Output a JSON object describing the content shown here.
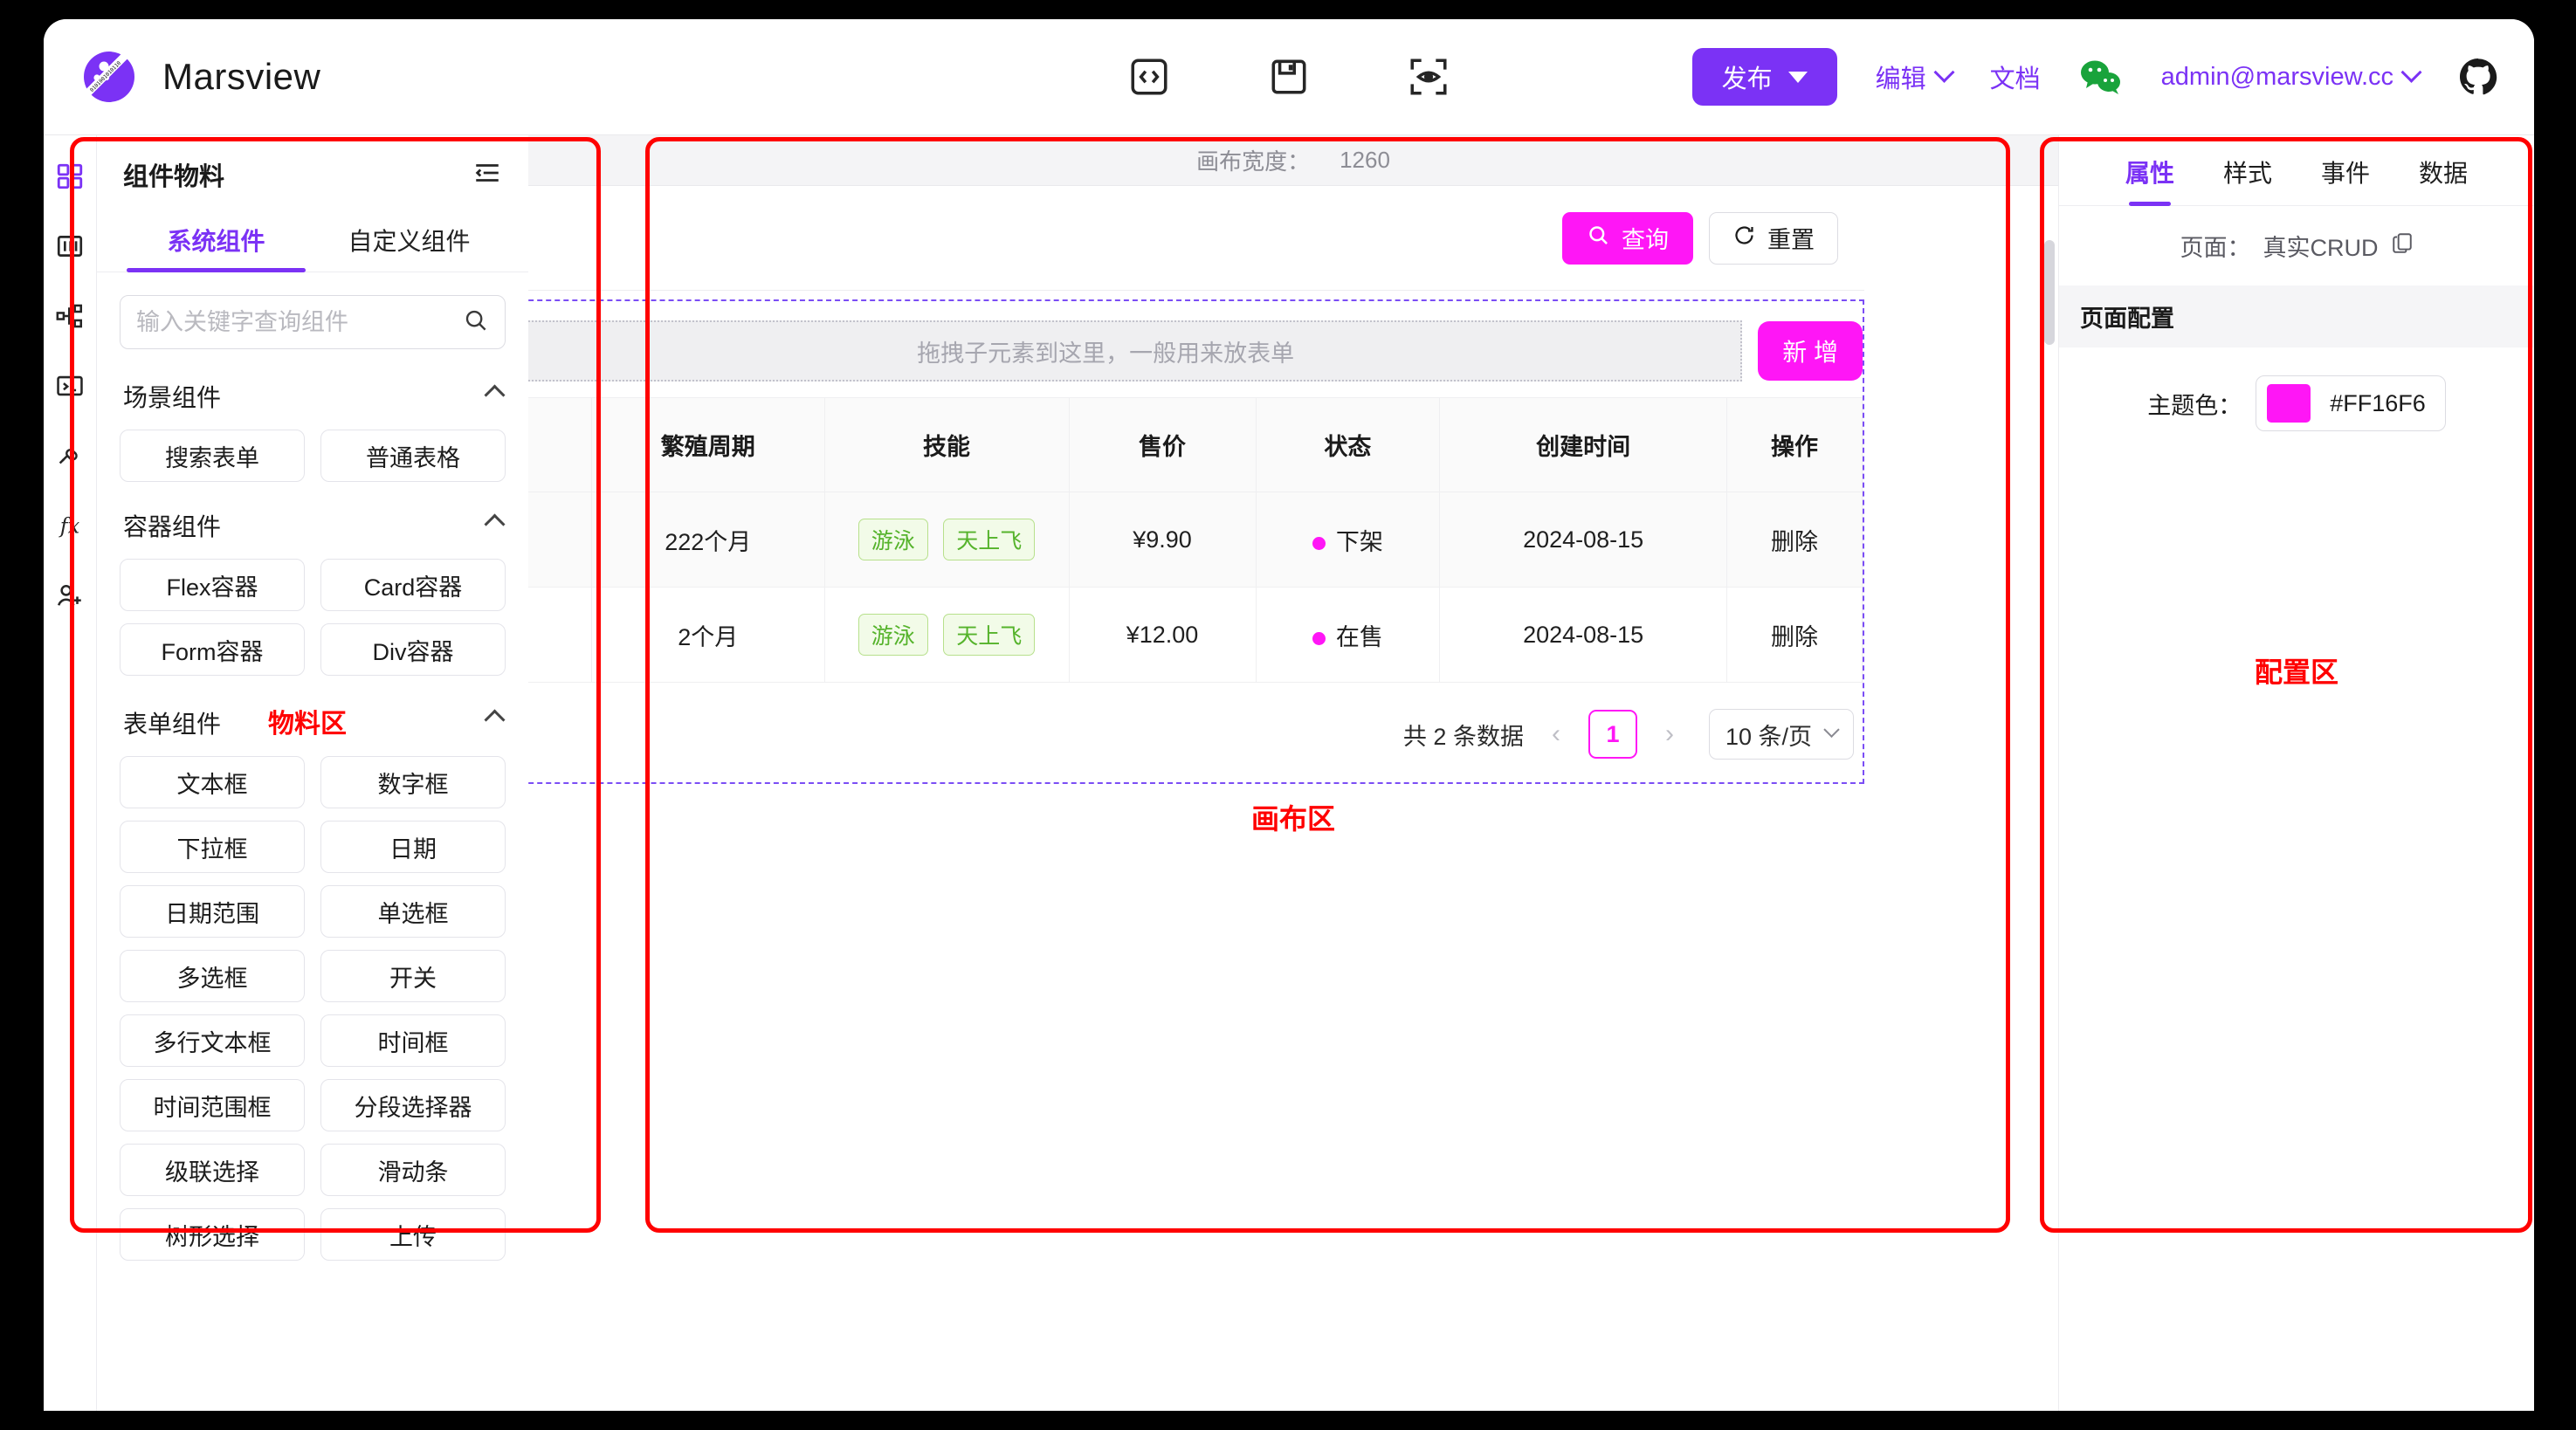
{
  "header": {
    "brand": "Marsview",
    "tools": [
      {
        "name": "code-icon",
        "label": "代码"
      },
      {
        "name": "save-icon",
        "label": "保存"
      },
      {
        "name": "preview-icon",
        "label": "预览"
      }
    ],
    "publish_label": "发布",
    "edit_label": "编辑",
    "docs_label": "文档",
    "wechat_label": "微信",
    "account": "admin@marsview.cc",
    "github_label": "GitHub",
    "brand_color": "#7b32f5"
  },
  "rail": {
    "items": [
      {
        "icon": "grid-icon",
        "label": "组件",
        "active": true
      },
      {
        "icon": "layout-icon",
        "label": "布局",
        "active": false
      },
      {
        "icon": "tree-icon",
        "label": "大纲树",
        "active": false
      },
      {
        "icon": "terminal-icon",
        "label": "代码",
        "active": false
      },
      {
        "icon": "plugin-icon",
        "label": "插件",
        "active": false
      },
      {
        "icon": "function-icon",
        "label": "函数",
        "active": false
      },
      {
        "icon": "user-add-icon",
        "label": "协作",
        "active": false
      }
    ]
  },
  "material": {
    "title": "组件物料",
    "collapse_icon": "collapse-panel-icon",
    "tabs": [
      {
        "label": "系统组件",
        "active": true
      },
      {
        "label": "自定义组件",
        "active": false
      }
    ],
    "search_placeholder": "输入关键字查询组件",
    "search_value": "",
    "annotation": "物料区",
    "groups": [
      {
        "title": "场景组件",
        "collapsed": false,
        "note": "",
        "items": [
          "搜索表单",
          "普通表格"
        ]
      },
      {
        "title": "容器组件",
        "collapsed": false,
        "note": "",
        "items": [
          "Flex容器",
          "Card容器",
          "Form容器",
          "Div容器"
        ]
      },
      {
        "title": "表单组件",
        "collapsed": false,
        "note": "物料区",
        "items": [
          "文本框",
          "数字框",
          "下拉框",
          "日期",
          "日期范围",
          "单选框",
          "多选框",
          "开关",
          "多行文本框",
          "时间框",
          "时间范围框",
          "分段选择器",
          "级联选择",
          "滑动条",
          "树形选择",
          "上传"
        ]
      }
    ]
  },
  "canvas": {
    "ruler_label": "画布宽度：",
    "ruler_value": "1260",
    "annotation": "画布区",
    "query_label": "查询",
    "reset_label": "重置",
    "dropzone_text": "拖拽子元素到这里，一般用来放表单",
    "add_label": "新 增",
    "table": {
      "columns": [
        "",
        "繁殖周期",
        "技能",
        "售价",
        "状态",
        "创建时间",
        "操作"
      ],
      "rows": [
        {
          "blank": "",
          "cycle": "222个月",
          "skills": [
            "游泳",
            "天上飞"
          ],
          "price": "¥9.90",
          "status": "下架",
          "created": "2024-08-15",
          "action": "删除"
        },
        {
          "blank": "",
          "cycle": "2个月",
          "skills": [
            "游泳",
            "天上飞"
          ],
          "price": "¥12.00",
          "status": "在售",
          "created": "2024-08-15",
          "action": "删除"
        }
      ]
    },
    "pagination": {
      "total": "共 2 条数据",
      "prev": "‹",
      "current": "1",
      "next": "›",
      "page_size": "10 条/页"
    }
  },
  "config": {
    "annotation": "配置区",
    "tabs": [
      {
        "label": "属性",
        "active": true
      },
      {
        "label": "样式",
        "active": false
      },
      {
        "label": "事件",
        "active": false
      },
      {
        "label": "数据",
        "active": false
      }
    ],
    "page_label": "页面：",
    "page_name": "真实CRUD",
    "copy_icon": "copy-icon",
    "section_title": "页面配置",
    "theme_label": "主题色：",
    "theme_color": "#FF16F6"
  }
}
